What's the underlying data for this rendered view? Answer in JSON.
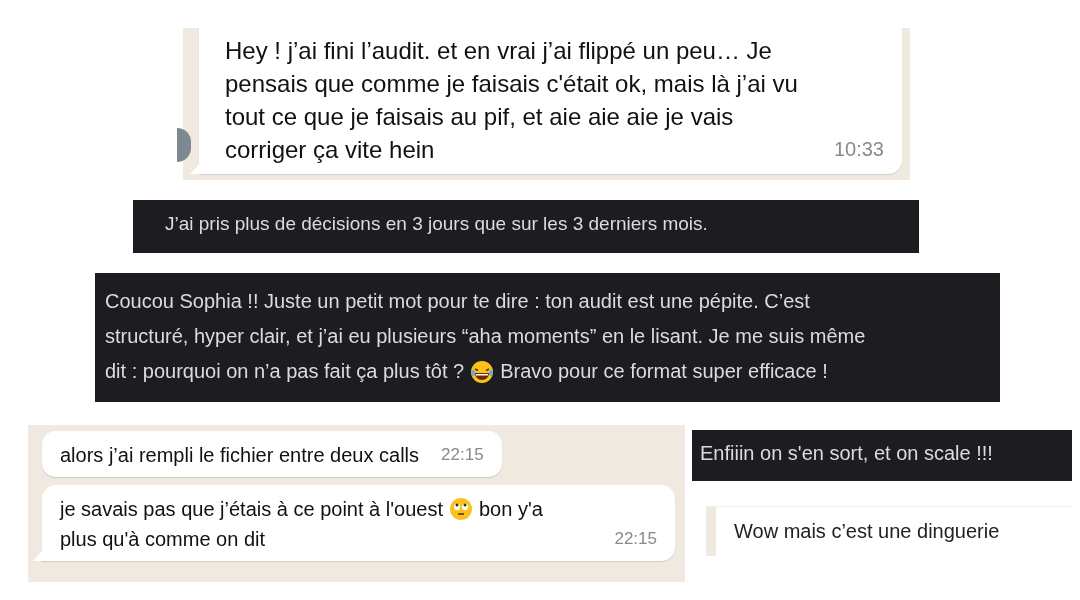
{
  "snippets": [
    {
      "kind": "whatsapp",
      "avatar": true,
      "messages": [
        {
          "lines": [
            [
              {
                "kind": "text",
                "text": "Hey ! j’ai fini l’audit. et en vrai j’ai flippé un peu… Je"
              }
            ],
            [
              {
                "kind": "text",
                "text": "pensais que comme je faisais c'était ok, mais là j’ai vu"
              }
            ],
            [
              {
                "kind": "text",
                "text": "tout ce que je faisais au pif, et aie aie aie je vais"
              }
            ],
            [
              {
                "kind": "text",
                "text": "corriger ça vite hein"
              }
            ]
          ],
          "time": "10:33",
          "tail": true
        }
      ]
    },
    {
      "kind": "slack",
      "messages": [
        {
          "lines": [
            [
              {
                "kind": "text",
                "text": "J’ai pris plus de décisions en 3 jours que sur les 3 derniers mois."
              }
            ]
          ]
        }
      ]
    },
    {
      "kind": "slack",
      "messages": [
        {
          "lines": [
            [
              {
                "kind": "text",
                "text": "Coucou Sophia !! Juste un petit mot pour te dire : ton audit est une pépite. C’est"
              }
            ],
            [
              {
                "kind": "text",
                "text": "structuré, hyper clair, et j’ai eu plusieurs “aha moments” en le lisant. Je me suis même"
              }
            ],
            [
              {
                "kind": "text",
                "text": "dit : pourquoi on n’a pas fait ça plus tôt ?"
              },
              {
                "kind": "laughing-emoji"
              },
              {
                "kind": "text",
                "text": "Bravo pour ce format super efficace !"
              }
            ]
          ]
        }
      ]
    },
    {
      "kind": "whatsapp",
      "avatar": false,
      "messages": [
        {
          "lines": [
            [
              {
                "kind": "text",
                "text": "alors j’ai rempli le fichier entre deux calls"
              }
            ]
          ],
          "time": "22:15",
          "tail": false
        },
        {
          "lines": [
            [
              {
                "kind": "text",
                "text": "je savais pas que j’étais à ce point à l'ouest"
              },
              {
                "kind": "eye-roll-emoji"
              },
              {
                "kind": "text",
                "text": "bon y'a"
              }
            ],
            [
              {
                "kind": "text",
                "text": "plus qu'à comme on dit"
              }
            ]
          ],
          "time": "22:15",
          "tail": true
        }
      ]
    },
    {
      "kind": "slack",
      "messages": [
        {
          "lines": [
            [
              {
                "kind": "text",
                "text": "Enfiiin on s'en sort, et on scale !!!"
              }
            ]
          ]
        }
      ]
    },
    {
      "kind": "plain",
      "messages": [
        {
          "lines": [
            [
              {
                "kind": "text",
                "text": "Wow mais c’est une dinguerie"
              }
            ]
          ]
        }
      ]
    }
  ]
}
